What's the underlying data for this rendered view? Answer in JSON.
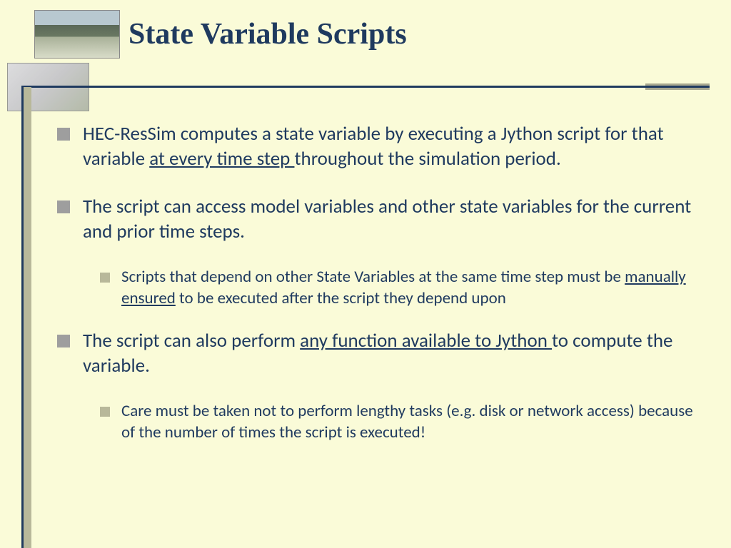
{
  "title": "State Variable Scripts",
  "bullets": {
    "b1_pre": "HEC-ResSim computes a state variable by executing a Jython script for that variable ",
    "b1_u": "at every time step ",
    "b1_post": "throughout the simulation period.",
    "b2": "The script can access model variables and other state variables for the current and prior time steps.",
    "b2a_pre": "Scripts that depend on other State Variables at the same time step must be ",
    "b2a_u": "manually ensured",
    "b2a_post": " to be executed after the script they depend upon",
    "b3_pre": "The script can also perform ",
    "b3_u": "any function available to Jython ",
    "b3_post": "to compute the variable.",
    "b3a": "Care must be taken not to perform lengthy tasks (e.g. disk or network access) because of the number of times the script is executed!"
  }
}
